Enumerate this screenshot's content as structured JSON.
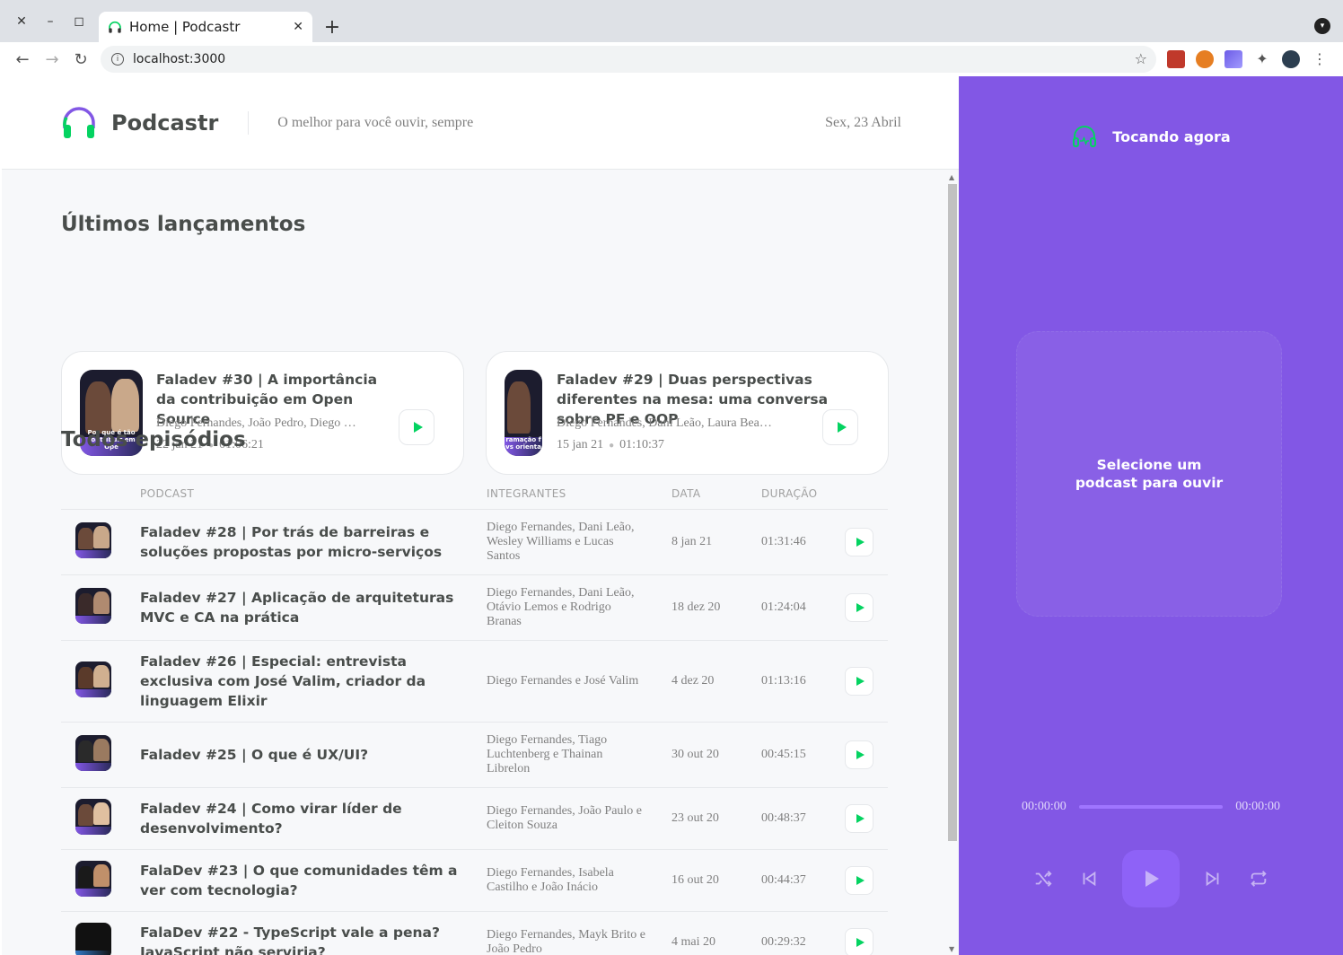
{
  "browser": {
    "tab_title": "Home | Podcastr",
    "url": "localhost:3000"
  },
  "header": {
    "app_name": "Podcastr",
    "tagline": "O melhor para você ouvir, sempre",
    "date": "Sex, 23 Abril"
  },
  "latest": {
    "title": "Últimos lançamentos",
    "episodes": [
      {
        "title": "Faladev #30 | A importância da contribuição em Open Source",
        "members": "Diego Fernandes, João Pedro, Diego …",
        "date": "22 jan 21",
        "duration": "01:06:21",
        "thumb_text": "Por que é tão contribuir em Ope"
      },
      {
        "title": "Faladev #29 | Duas perspectivas diferentes na mesa: uma conversa sobre PF e OOP",
        "members": "Diego Fernandes, Dani Leão, Laura Bea…",
        "date": "15 jan 21",
        "duration": "01:10:37",
        "thumb_text": "ramação f vs orienta"
      }
    ]
  },
  "all": {
    "title": "Todos episódios",
    "columns": [
      "PODCAST",
      "INTEGRANTES",
      "DATA",
      "DURAÇÃO"
    ],
    "episodes": [
      {
        "title": "Faladev #28 | Por trás de barreiras e soluções propostas por micro-serviços",
        "members": "Diego Fernandes, Dani Leão, Wesley Williams e Lucas Santos",
        "date": "8 jan 21",
        "duration": "01:31:46"
      },
      {
        "title": "Faladev #27 | Aplicação de arquiteturas MVC e CA na prática",
        "members": "Diego Fernandes, Dani Leão, Otávio Lemos e Rodrigo Branas",
        "date": "18 dez 20",
        "duration": "01:24:04"
      },
      {
        "title": "Faladev #26 | Especial: entrevista exclusiva com José Valim, criador da linguagem Elixir",
        "members": "Diego Fernandes e José Valim",
        "date": "4 dez 20",
        "duration": "01:13:16"
      },
      {
        "title": "Faladev #25 | O que é UX/UI?",
        "members": "Diego Fernandes, Tiago Luchtenberg e Thainan Librelon",
        "date": "30 out 20",
        "duration": "00:45:15"
      },
      {
        "title": "Faladev #24 | Como virar líder de desenvolvimento?",
        "members": "Diego Fernandes, João Paulo e Cleiton Souza",
        "date": "23 out 20",
        "duration": "00:48:37"
      },
      {
        "title": "FalaDev #23 | O que comunidades têm a ver com tecnologia?",
        "members": "Diego Fernandes, Isabela Castilho e João Inácio",
        "date": "16 out 20",
        "duration": "00:44:37"
      },
      {
        "title": "FalaDev #22 - TypeScript vale a pena? JavaScript não serviria?",
        "members": "Diego Fernandes, Mayk Brito e João Pedro",
        "date": "4 mai 20",
        "duration": "00:29:32"
      }
    ]
  },
  "player": {
    "title": "Tocando agora",
    "empty_message": "Selecione um podcast para ouvir",
    "current_time": "00:00:00",
    "total_time": "00:00:00"
  },
  "colors": {
    "accent": "#8257e5",
    "play_green": "#04d361",
    "text": "#494d4b",
    "muted": "#808080"
  }
}
